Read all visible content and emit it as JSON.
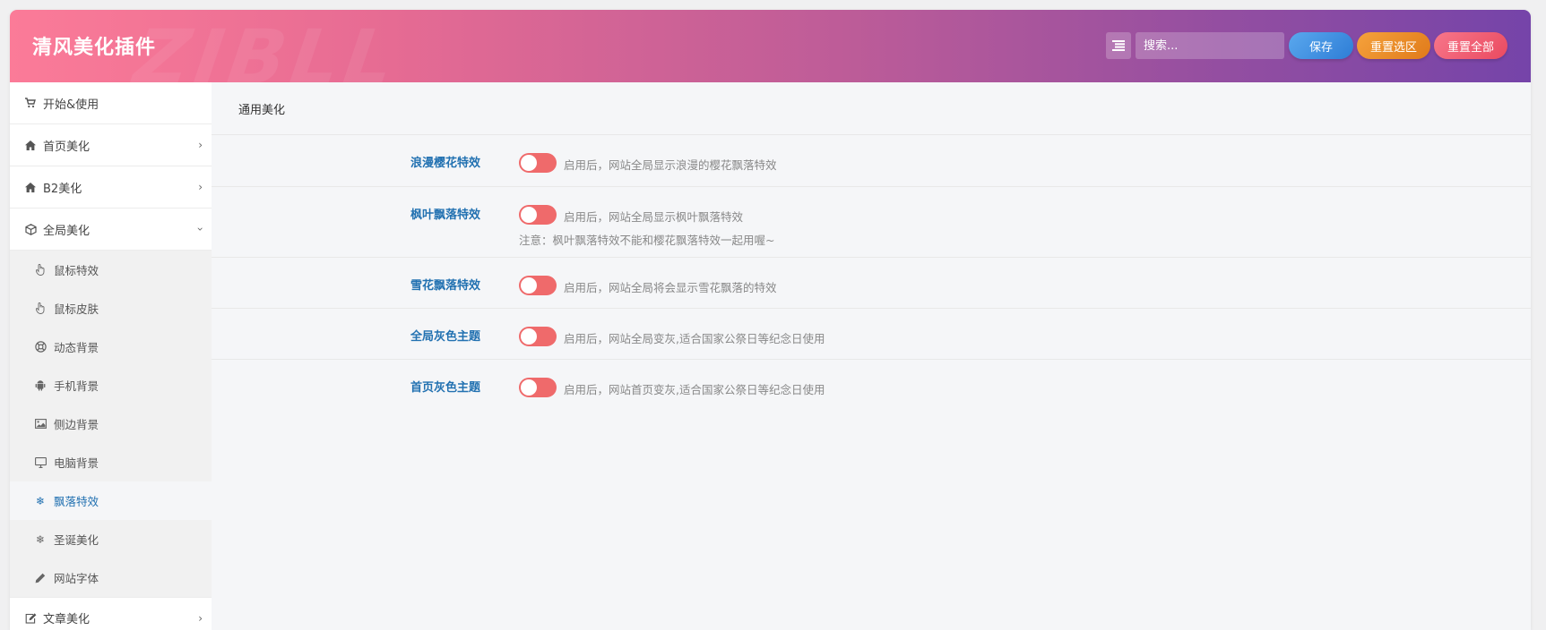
{
  "header": {
    "title": "清风美化插件",
    "watermark": "ZIBLL",
    "search_placeholder": "搜索...",
    "save_label": "保存",
    "reset_section_label": "重置选区",
    "reset_all_label": "重置全部"
  },
  "sidebar": {
    "items": [
      {
        "label": "开始&使用",
        "icon": "cart-icon"
      },
      {
        "label": "首页美化",
        "icon": "home-icon"
      },
      {
        "label": "B2美化",
        "icon": "home-icon"
      },
      {
        "label": "全局美化",
        "icon": "cube-icon"
      }
    ],
    "sub_items": [
      {
        "label": "鼠标特效",
        "icon": "pointer-hand-icon"
      },
      {
        "label": "鼠标皮肤",
        "icon": "pointer-hand-icon"
      },
      {
        "label": "动态背景",
        "icon": "lifebuoy-icon"
      },
      {
        "label": "手机背景",
        "icon": "android-icon"
      },
      {
        "label": "侧边背景",
        "icon": "image-icon"
      },
      {
        "label": "电脑背景",
        "icon": "desktop-icon"
      },
      {
        "label": "飘落特效",
        "icon": "snowflake-icon"
      },
      {
        "label": "圣诞美化",
        "icon": "snowflake-icon"
      },
      {
        "label": "网站字体",
        "icon": "pencil-icon"
      }
    ],
    "bottom_item": {
      "label": "文章美化",
      "icon": "edit-icon"
    }
  },
  "main": {
    "section_title": "通用美化",
    "fields": [
      {
        "label": "浪漫樱花特效",
        "desc": "启用后，网站全局显示浪漫的樱花飘落特效",
        "enabled": false
      },
      {
        "label": "枫叶飘落特效",
        "desc": "启用后，网站全局显示枫叶飘落特效",
        "note": "注意：枫叶飘落特效不能和樱花飘落特效一起用喔~",
        "enabled": false
      },
      {
        "label": "雪花飘落特效",
        "desc": "启用后，网站全局将会显示雪花飘落的特效",
        "enabled": false
      },
      {
        "label": "全局灰色主题",
        "desc": "启用后，网站全局变灰,适合国家公祭日等纪念日使用",
        "enabled": false
      },
      {
        "label": "首页灰色主题",
        "desc": "启用后，网站首页变灰,适合国家公祭日等纪念日使用",
        "enabled": false
      }
    ]
  },
  "colors": {
    "accent": "#2271b1",
    "toggle_off": "#ef6a6b",
    "save_btn": "#2e7dd6",
    "reset_section_btn": "#e8891f",
    "reset_all_btn": "#ee5468"
  }
}
